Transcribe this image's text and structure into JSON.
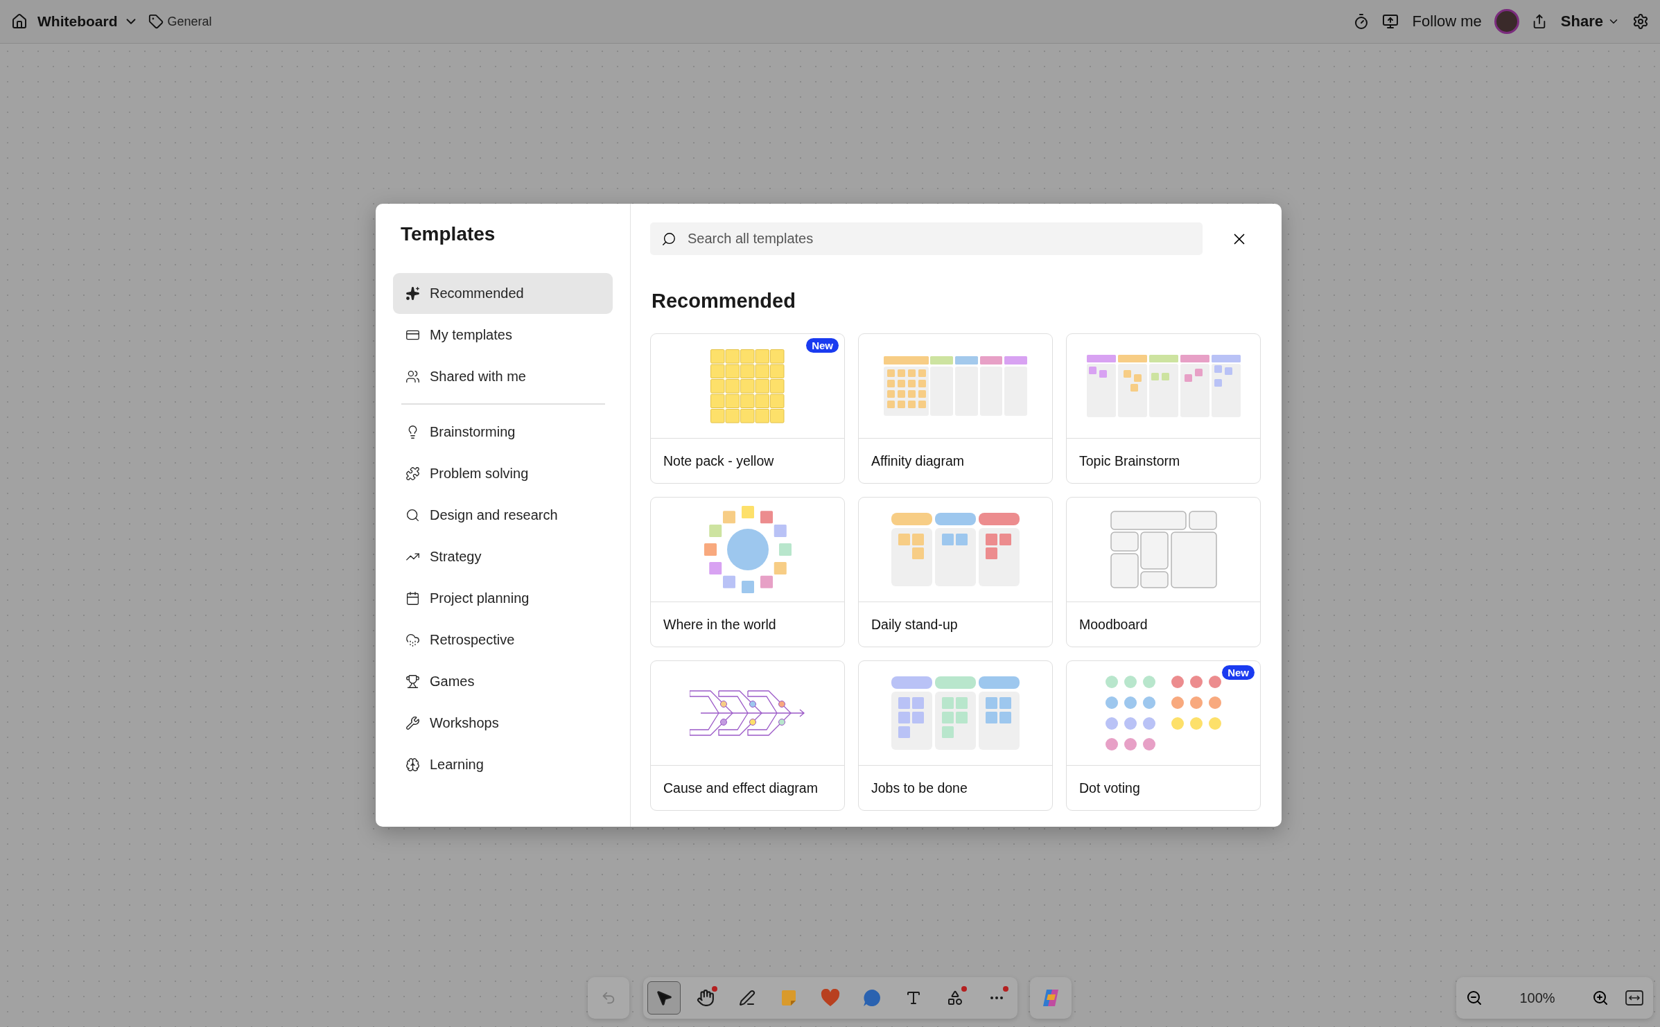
{
  "top_bar": {
    "title": "Whiteboard",
    "channel": "General",
    "follow": "Follow me",
    "share": "Share"
  },
  "templates_dialog": {
    "title": "Templates",
    "search": {
      "placeholder": "Search all templates"
    },
    "heading": "Recommended",
    "sidebar_sections": [
      {
        "items": [
          {
            "label": "Recommended",
            "kind": "sparkles",
            "selected": true
          },
          {
            "label": "My templates",
            "kind": "card",
            "selected": false
          },
          {
            "label": "Shared with me",
            "kind": "people",
            "selected": false
          }
        ]
      },
      {
        "items": [
          {
            "label": "Brainstorming",
            "kind": "bulb",
            "selected": false
          },
          {
            "label": "Problem solving",
            "kind": "puzzle",
            "selected": false
          },
          {
            "label": "Design and research",
            "kind": "search",
            "selected": false
          },
          {
            "label": "Strategy",
            "kind": "chart",
            "selected": false
          },
          {
            "label": "Project planning",
            "kind": "calendar",
            "selected": false
          },
          {
            "label": "Retrospective",
            "kind": "cloud",
            "selected": false
          },
          {
            "label": "Games",
            "kind": "trophy",
            "selected": false
          },
          {
            "label": "Workshops",
            "kind": "wrench",
            "selected": false
          },
          {
            "label": "Learning",
            "kind": "brain",
            "selected": false
          }
        ]
      }
    ],
    "cards": [
      {
        "label": "Note pack - yellow",
        "kind": "notes",
        "badge": "New"
      },
      {
        "label": "Affinity diagram",
        "kind": "affinity"
      },
      {
        "label": "Topic Brainstorm",
        "kind": "topic"
      },
      {
        "label": "Where in the world",
        "kind": "world"
      },
      {
        "label": "Daily stand-up",
        "kind": "standup"
      },
      {
        "label": "Moodboard",
        "kind": "moodboard"
      },
      {
        "label": "Cause and effect diagram",
        "kind": "fishbone"
      },
      {
        "label": "Jobs to be done",
        "kind": "jobs"
      },
      {
        "label": "Dot voting",
        "kind": "dots",
        "badge": "New"
      }
    ]
  },
  "toolbar": {
    "undo": {
      "disabled": true
    },
    "tools": [
      {
        "kind": "select",
        "selected": true,
        "alert": false
      },
      {
        "kind": "hand",
        "selected": false,
        "alert": true
      },
      {
        "kind": "pen",
        "selected": false,
        "alert": false
      },
      {
        "kind": "note",
        "selected": false,
        "alert": false
      },
      {
        "kind": "reaction",
        "selected": false,
        "alert": false
      },
      {
        "kind": "comment",
        "selected": false,
        "alert": false
      },
      {
        "kind": "text",
        "selected": false,
        "alert": false
      },
      {
        "kind": "shapes",
        "selected": false,
        "alert": true
      },
      {
        "kind": "more",
        "selected": false,
        "alert": true
      }
    ]
  },
  "zoom": {
    "reading": "100%"
  }
}
